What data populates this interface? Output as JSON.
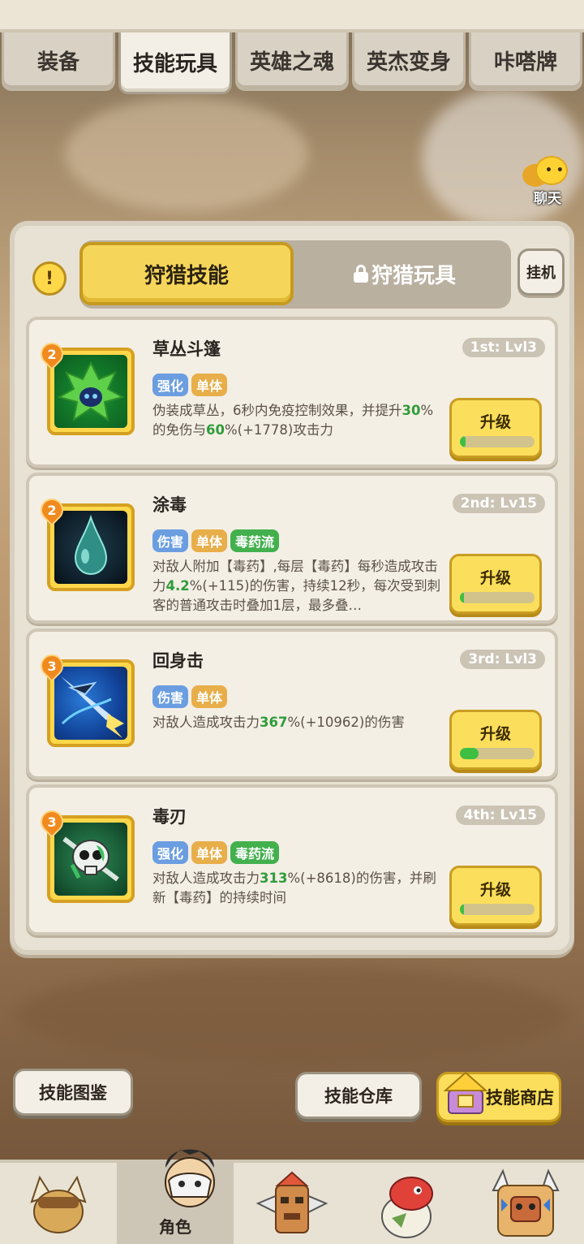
{
  "top_tabs": [
    {
      "label": "装备"
    },
    {
      "label": "技能玩具"
    },
    {
      "label": "英雄之魂"
    },
    {
      "label": "英杰变身"
    },
    {
      "label": "咔嗒牌"
    }
  ],
  "chat": {
    "label": "聊天"
  },
  "info_icon": "!",
  "sub_tabs": {
    "active": "狩猎技能",
    "locked": "狩猎玩具"
  },
  "idle_button": "挂机",
  "skills": [
    {
      "badge": "2",
      "name": "草丛斗篷",
      "rank": "1st: Lvl3",
      "tags": [
        "强化",
        "单体"
      ],
      "desc_parts": [
        "伪装成草丛，6秒内免疫控制效果，并提升",
        "30",
        "%的免伤与",
        "60",
        "%(+1778)攻击力"
      ],
      "upgrade_label": "升级",
      "progress": 0.08,
      "icon": "bush-cloak-icon"
    },
    {
      "badge": "2",
      "name": "涂毒",
      "rank": "2nd: Lv15",
      "tags": [
        "伤害",
        "单体",
        "毒药流"
      ],
      "desc_parts": [
        "对敌人附加【毒药】,每层【毒药】每秒造成攻击力",
        "4.2",
        "%(+115)的伤害，持续12秒，每次受到刺客的普通攻击时叠加1层，最多叠…"
      ],
      "upgrade_label": "升级",
      "progress": 0.05,
      "icon": "poison-drop-icon"
    },
    {
      "badge": "3",
      "name": "回身击",
      "rank": "3rd: Lvl3",
      "tags": [
        "伤害",
        "单体"
      ],
      "desc_parts": [
        "对敌人造成攻击力",
        "367",
        "%(+10962)的伤害"
      ],
      "upgrade_label": "升级",
      "progress": 0.25,
      "icon": "spin-strike-icon"
    },
    {
      "badge": "3",
      "name": "毒刃",
      "rank": "4th: Lv15",
      "tags": [
        "强化",
        "单体",
        "毒药流"
      ],
      "desc_parts": [
        "对敌人造成攻击力",
        "313",
        "%(+8618)的伤害，并刷新【毒药】的持续时间"
      ],
      "upgrade_label": "升级",
      "progress": 0.05,
      "icon": "poison-blade-icon"
    }
  ],
  "bottom_buttons": {
    "catalog": "技能图鉴",
    "storage": "技能仓库",
    "shop": "技能商店"
  },
  "bottom_nav": [
    {
      "icon": "beast-hat-icon",
      "label": ""
    },
    {
      "icon": "hero-character-icon",
      "label": "角色"
    },
    {
      "icon": "totem-mask-icon",
      "label": ""
    },
    {
      "icon": "dino-pet-icon",
      "label": ""
    },
    {
      "icon": "tiki-monster-icon",
      "label": ""
    }
  ],
  "colors": {
    "accent_yellow": "#fbdf5c",
    "highlight_green": "#2f9c3a",
    "tag_blue": "#6b9ee0",
    "tag_orange": "#e8ae4a",
    "tag_green": "#43b04e"
  }
}
